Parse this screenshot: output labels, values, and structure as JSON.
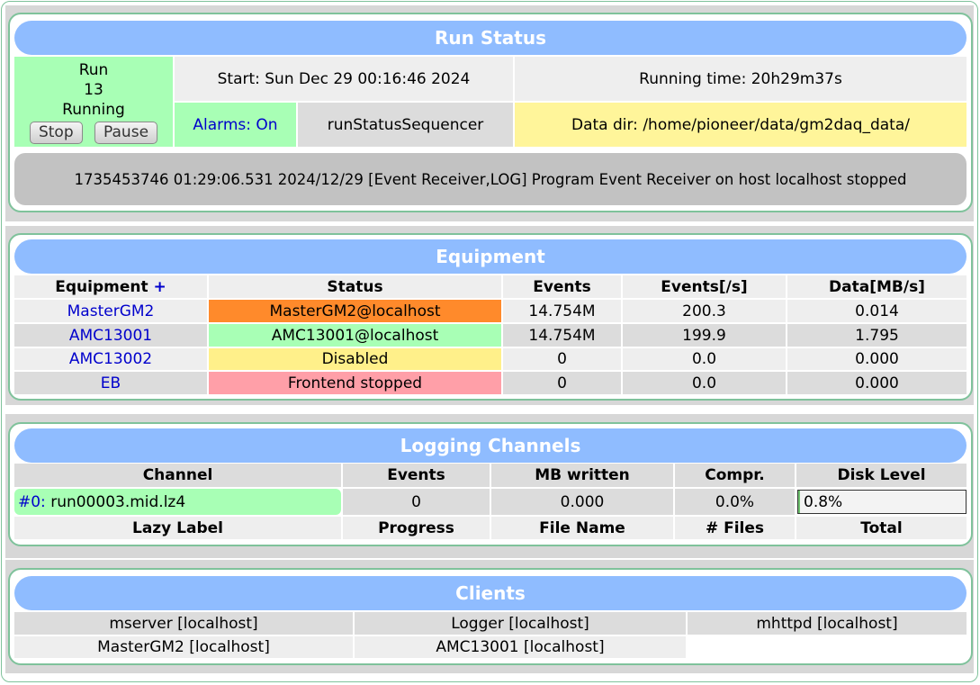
{
  "run_status": {
    "title": "Run Status",
    "run_label": "Run",
    "run_number": "13",
    "state": "Running",
    "stop_label": "Stop",
    "pause_label": "Pause",
    "start": "Start: Sun Dec 29 00:16:46 2024",
    "running_time": "Running time: 20h29m37s",
    "alarms": "Alarms: On",
    "sequencer": "runStatusSequencer",
    "data_dir": "Data dir: /home/pioneer/data/gm2daq_data/",
    "message": "1735453746 01:29:06.531 2024/12/29 [Event Receiver,LOG] Program Event Receiver on host localhost stopped"
  },
  "equipment": {
    "title": "Equipment",
    "headers": [
      "Equipment",
      "Status",
      "Events",
      "Events[/s]",
      "Data[MB/s]"
    ],
    "add_symbol": "+",
    "rows": [
      {
        "name": "MasterGM2",
        "status": "MasterGM2@localhost",
        "events": "14.754M",
        "rate": "200.3",
        "data": "0.014",
        "status_color": "#ff8a2b"
      },
      {
        "name": "AMC13001",
        "status": "AMC13001@localhost",
        "events": "14.754M",
        "rate": "199.9",
        "data": "1.795",
        "status_color": "#a8ffb5"
      },
      {
        "name": "AMC13002",
        "status": "Disabled",
        "events": "0",
        "rate": "0.0",
        "data": "0.000",
        "status_color": "#fff08a"
      },
      {
        "name": "EB",
        "status": "Frontend stopped",
        "events": "0",
        "rate": "0.0",
        "data": "0.000",
        "status_color": "#ff9fa8"
      }
    ]
  },
  "logging": {
    "title": "Logging Channels",
    "headers": [
      "Channel",
      "Events",
      "MB written",
      "Compr.",
      "Disk Level"
    ],
    "channel_id": "#0:",
    "channel_file": "run00003.mid.lz4",
    "events": "0",
    "mb_written": "0.000",
    "compr": "0.0%",
    "disk_level": "0.8%",
    "disk_fraction": 0.008,
    "lazy_headers": [
      "Lazy Label",
      "Progress",
      "File Name",
      "# Files",
      "Total"
    ]
  },
  "clients": {
    "title": "Clients",
    "items": [
      "mserver [localhost]",
      "Logger [localhost]",
      "mhttpd [localhost]",
      "MasterGM2 [localhost]",
      "AMC13001 [localhost]"
    ]
  },
  "colors": {
    "header_blue": "#8fbcff",
    "running_green": "#a8ffb5",
    "data_dir_yellow": "#fff59a",
    "frame_green": "#7fc29b"
  }
}
